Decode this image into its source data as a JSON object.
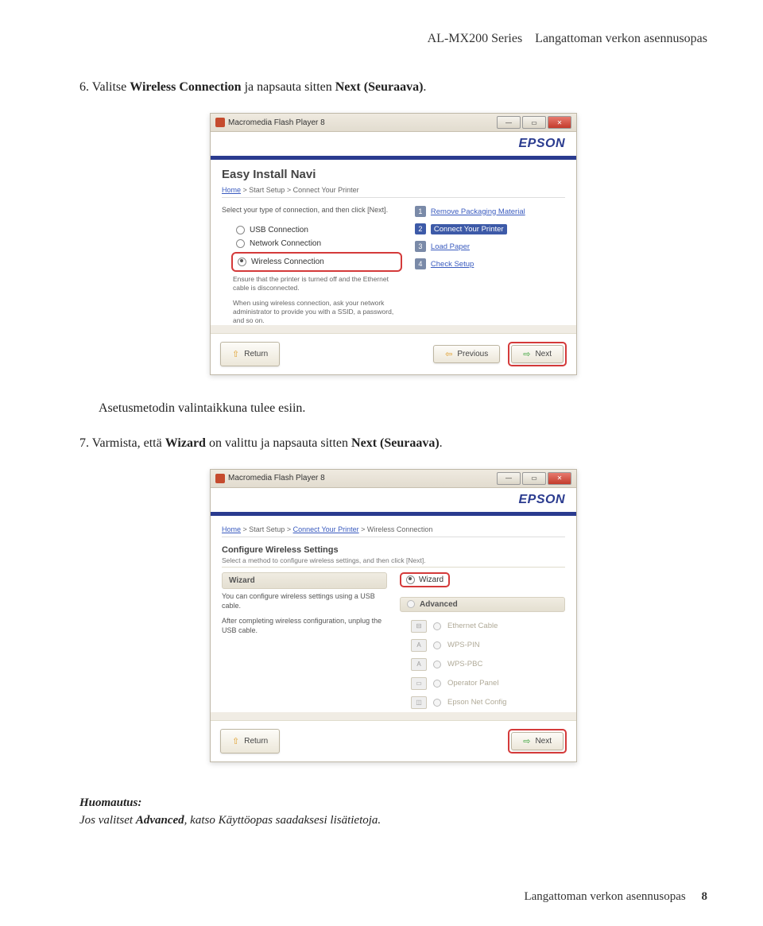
{
  "header": {
    "series": "AL-MX200 Series",
    "title": "Langattoman verkon asennusopas"
  },
  "step6": {
    "prefix": "6. Valitse ",
    "bold1": "Wireless Connection",
    "mid": " ja napsauta sitten ",
    "bold2": "Next (Seuraava)",
    "suffix": "."
  },
  "between_text": "Asetusmetodin valintaikkuna tulee esiin.",
  "step7": {
    "prefix": "7. Varmista, että ",
    "bold1": "Wizard",
    "mid": " on valittu ja napsauta sitten ",
    "bold2": "Next (Seuraava)",
    "suffix": "."
  },
  "note": {
    "head": "Huomautus:",
    "body_pre": "Jos valitset ",
    "body_bold": "Advanced",
    "body_post": ", katso Käyttöopas saadaksesi lisätietoja."
  },
  "footer": {
    "text": "Langattoman verkon asennusopas",
    "page": "8"
  },
  "shot1": {
    "win_title": "Macromedia Flash Player 8",
    "brand": "EPSON",
    "navi_title": "Easy Install Navi",
    "breadcrumb_home": "Home",
    "breadcrumb_sep": " > ",
    "breadcrumb_start": "Start Setup",
    "breadcrumb_connect": "Connect Your Printer",
    "intro": "Select your type of connection, and then click [Next].",
    "radio_usb": "USB Connection",
    "radio_net": "Network Connection",
    "radio_wireless": "Wireless Connection",
    "note1": "Ensure that the printer is turned off and the Ethernet cable is disconnected.",
    "note2": "When using wireless connection, ask your network administrator to provide you with a SSID, a password, and so on.",
    "steps": [
      {
        "n": "1",
        "label": "Remove Packaging Material",
        "active": false
      },
      {
        "n": "2",
        "label": "Connect Your Printer",
        "active": true
      },
      {
        "n": "3",
        "label": "Load Paper",
        "active": false
      },
      {
        "n": "4",
        "label": "Check Setup",
        "active": false
      }
    ],
    "btn_return": "Return",
    "btn_prev": "Previous",
    "btn_next": "Next"
  },
  "shot2": {
    "win_title": "Macromedia Flash Player 8",
    "brand": "EPSON",
    "breadcrumb_home": "Home",
    "breadcrumb_sep": " > ",
    "breadcrumb_start": "Start Setup",
    "breadcrumb_connect": "Connect Your Printer",
    "breadcrumb_wireless": "Wireless Connection",
    "section_title": "Configure Wireless Settings",
    "section_sub": "Select a method to configure wireless settings, and then click [Next].",
    "wizard_bar": "Wizard",
    "wizard_sel": "Wizard",
    "wizard_text1": "You can configure wireless settings using a USB cable.",
    "wizard_text2": "After completing wireless configuration, unplug the USB cable.",
    "advanced_bar": "Advanced",
    "adv_items": [
      "Ethernet Cable",
      "WPS-PIN",
      "WPS-PBC",
      "Operator Panel",
      "Epson Net Config"
    ],
    "btn_return": "Return",
    "btn_next": "Next"
  }
}
